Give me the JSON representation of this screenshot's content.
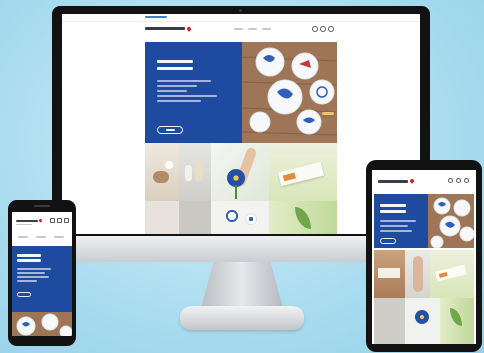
{
  "colors": {
    "background": "#a9dcef",
    "brand_blue": "#1e4b9f",
    "wood": "#9e7556",
    "bezel": "#121212",
    "silver": "#d5d7da",
    "logo_red": "#d8232a"
  },
  "icons": {
    "header_search": "search-icon",
    "header_account": "account-icon",
    "header_menu": "menu-icon"
  }
}
